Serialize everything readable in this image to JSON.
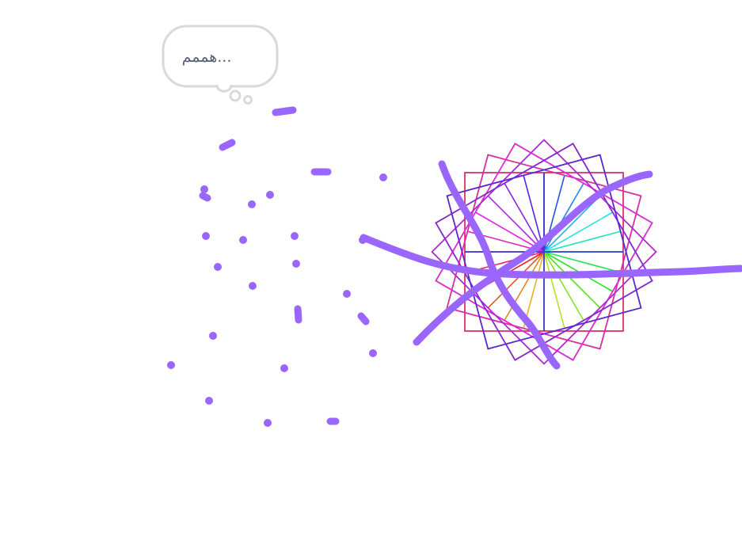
{
  "stage": {
    "background": "#ffffff"
  },
  "speech_bubble": {
    "text": "هممم...",
    "style": "think",
    "border_color": "#d9d9d9",
    "text_color": "#575e75"
  },
  "pen": {
    "color": "#9966ff"
  },
  "rainbow_squares": {
    "count": 24,
    "rotation_step_degrees": 15
  }
}
